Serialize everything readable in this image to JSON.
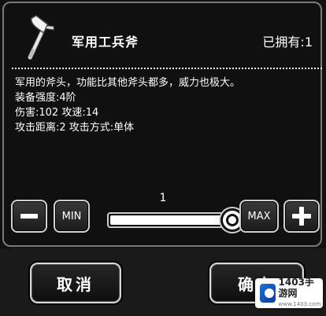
{
  "item": {
    "name": "军用工兵斧",
    "owned": "已拥有:1",
    "icon": "axe-icon",
    "description": [
      "军用的斧头，功能比其他斧头都多，威力也极大。",
      " 装备强度:4阶",
      "伤害:102 攻速:14",
      " 攻击距离:2 攻击方式:单体"
    ]
  },
  "quantity": {
    "value": "1",
    "min_label": "MIN",
    "max_label": "MAX",
    "slider_fraction": 1.0
  },
  "actions": {
    "cancel": "取消",
    "confirm": "确定"
  },
  "watermark": {
    "text": "1403手游网",
    "sub": "www.1403.com"
  },
  "colors": {
    "background": "#111111",
    "border": "#d0d0d0",
    "text": "#ffffff"
  }
}
